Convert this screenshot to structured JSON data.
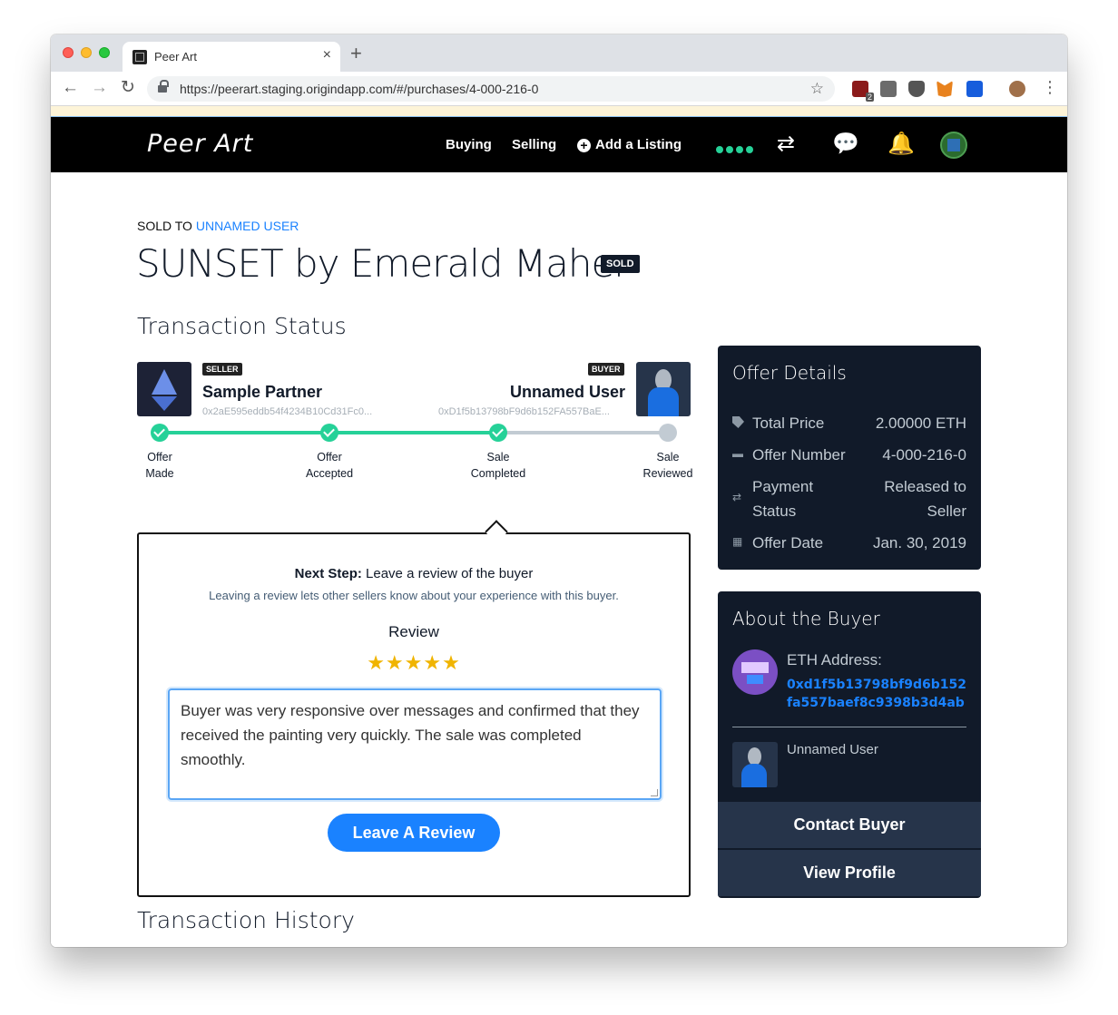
{
  "browser": {
    "tab_title": "Peer Art",
    "tab_close": "×",
    "new_tab": "+",
    "url": "https://peerart.staging.origindapp.com/#/purchases/4-000-216-0",
    "ublock_count": "2",
    "icons": {
      "back": "←",
      "forward": "→",
      "reload": "↻",
      "bookmark": "☆",
      "menu": "⋮"
    }
  },
  "header": {
    "logo": "Peer Art",
    "nav": {
      "buying": "Buying",
      "selling": "Selling",
      "add_listing": "Add a Listing"
    },
    "plus_glyph": "+",
    "icons": {
      "transfer": "⇄",
      "messages": "💬",
      "notifications": "🔔"
    },
    "status_color": "#26d198"
  },
  "listing": {
    "sold_to_prefix": "SOLD TO",
    "sold_to_name": "UNNAMED USER",
    "title": "SUNSET by Emerald Maher",
    "badge": "SOLD"
  },
  "transaction_status": {
    "heading": "Transaction Status",
    "seller": {
      "role": "SELLER",
      "name": "Sample Partner",
      "address": "0x2aE595eddb54f4234B10Cd31Fc0..."
    },
    "buyer": {
      "role": "BUYER",
      "name": "Unnamed User",
      "address": "0xD1f5b13798bF9d6b152FA557BaE..."
    },
    "steps": [
      {
        "line1": "Offer",
        "line2": "Made",
        "done": true
      },
      {
        "line1": "Offer",
        "line2": "Accepted",
        "done": true
      },
      {
        "line1": "Sale",
        "line2": "Completed",
        "done": true
      },
      {
        "line1": "Sale",
        "line2": "Reviewed",
        "done": false
      }
    ]
  },
  "next_step": {
    "label": "Next Step:",
    "text": "Leave a review of the buyer",
    "subtext": "Leaving a review lets other sellers know about your experience with this buyer.",
    "review_label": "Review",
    "stars": "★★★★★",
    "rating": 5,
    "review_text": "Buyer was very responsive over messages and confirmed that they received the painting very quickly. The sale was completed smoothly.",
    "button": "Leave A Review"
  },
  "offer_details": {
    "title": "Offer Details",
    "rows": [
      {
        "label": "Total Price",
        "value": "2.00000 ETH",
        "icon": "tag-icon"
      },
      {
        "label": "Offer Number",
        "value": "4-000-216-0",
        "icon": "hash-icon"
      },
      {
        "label": "Payment Status",
        "value": "Released to Seller",
        "icon": "transfer-icon"
      },
      {
        "label": "Offer Date",
        "value": "Jan. 30, 2019",
        "icon": "calendar-icon"
      }
    ],
    "glyphs": {
      "hash": "▬",
      "transfer": "⇄",
      "calendar": "▦"
    }
  },
  "about_buyer": {
    "title": "About the Buyer",
    "eth_label": "ETH Address:",
    "eth_address": "0xd1f5b13798bf9d6b152fa557baef8c9398b3d4ab",
    "name": "Unnamed User",
    "contact_button": "Contact Buyer",
    "profile_button": "View Profile"
  },
  "history": {
    "heading": "Transaction History"
  }
}
